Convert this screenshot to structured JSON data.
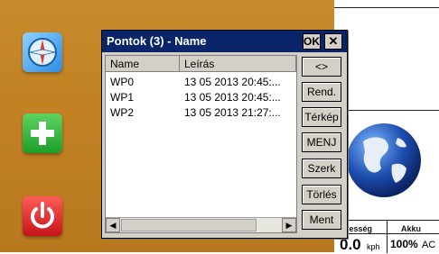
{
  "desktop": {
    "icons": [
      "compass-icon",
      "plus-icon",
      "power-icon"
    ]
  },
  "dialog": {
    "title": "Pontok (3) - Name",
    "ok_label": "OK",
    "close_label": "✕",
    "columns": [
      "Name",
      "Leírás"
    ],
    "rows": [
      {
        "name": "WP0",
        "desc": "13 05 2013 20:45:..."
      },
      {
        "name": "WP1",
        "desc": "13 05 2013 20:45:..."
      },
      {
        "name": "WP2",
        "desc": "13 05 2013 21:27:..."
      }
    ],
    "buttons": [
      "<>",
      "Rend.",
      "Térkép",
      "MENJ",
      "Szerk",
      "Törlés",
      "Ment"
    ],
    "scroll_left": "◀",
    "scroll_right": "▶"
  },
  "status": {
    "speed_label": "ebesség",
    "battery_label": "Akku",
    "speed_value": "0.0",
    "speed_unit": "kph",
    "battery_value": "100%",
    "battery_unit": "AC"
  },
  "colors": {
    "desktop": "#c3852a",
    "titlebar": "#0a246a",
    "dialog_bg": "#d4d0c8"
  }
}
